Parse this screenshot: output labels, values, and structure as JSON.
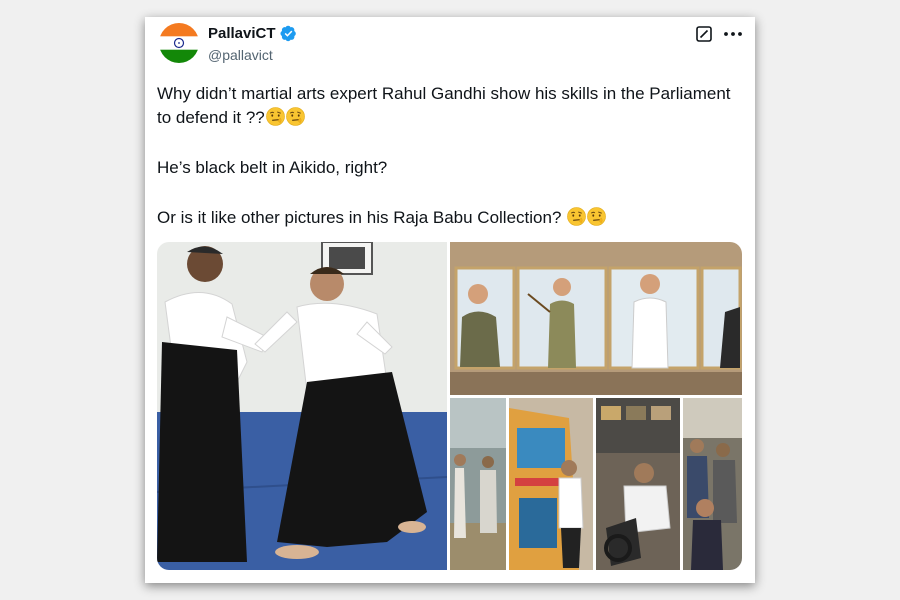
{
  "tweet": {
    "author": {
      "display_name": "PallaviCT",
      "handle": "@pallavict",
      "avatar": "india-flag-avatar",
      "verified_badge": "verified-badge-icon"
    },
    "actions": {
      "grok_icon": "grok-slash-icon",
      "more_icon": "more-dots-icon"
    },
    "text": {
      "p1": "Why didn’t martial arts expert Rahul Gandhi show his skills in the Parliament to defend it ??",
      "p2": "He’s black belt in Aikido, right?",
      "p3": "Or is it like other pictures in his Raja Babu Collection?"
    },
    "emoji": "raised-eyebrow-face",
    "media": {
      "layout": "two-column: left tall photo, right stack (1 wide top + 4 small bottom)"
    }
  },
  "colors": {
    "background": "#f0f0f0",
    "card": "#ffffff",
    "text": "#0f1419",
    "secondary": "#536471",
    "verified": "#1d9bf0"
  }
}
